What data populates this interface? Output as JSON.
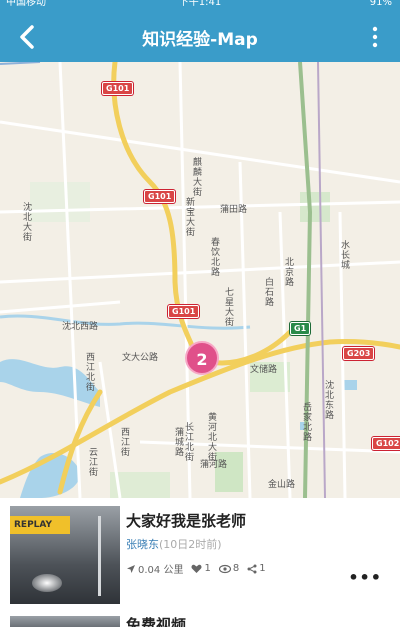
{
  "status_bar": {
    "carrier": "中国移动",
    "time": "下午1:41",
    "battery": "91%"
  },
  "nav": {
    "title": "知识经验-Map"
  },
  "map": {
    "shields": [
      "G101",
      "G101",
      "G101",
      "G1",
      "G203",
      "G102"
    ],
    "road_labels": [
      "麒麟大街",
      "新宝大街",
      "蒲田路",
      "沈北大街",
      "水长城",
      "北京路",
      "白石路",
      "沈北西路",
      "文大公路",
      "文储路",
      "西江北街",
      "七星大街",
      "春饮北路",
      "黄河北大街",
      "长江北街",
      "蒲河路",
      "金山路",
      "岳家北路",
      "沈北东路",
      "蒲城路",
      "西江街",
      "云江街"
    ],
    "cluster_count": "2"
  },
  "items": [
    {
      "badge": "REPLAY",
      "title": "大家好我是张老师",
      "author": "张晓东",
      "time": "(10日2时前)",
      "distance": "0.04 公里",
      "likes": "1",
      "views": "8",
      "shares": "1"
    },
    {
      "title": "免费视频"
    }
  ]
}
